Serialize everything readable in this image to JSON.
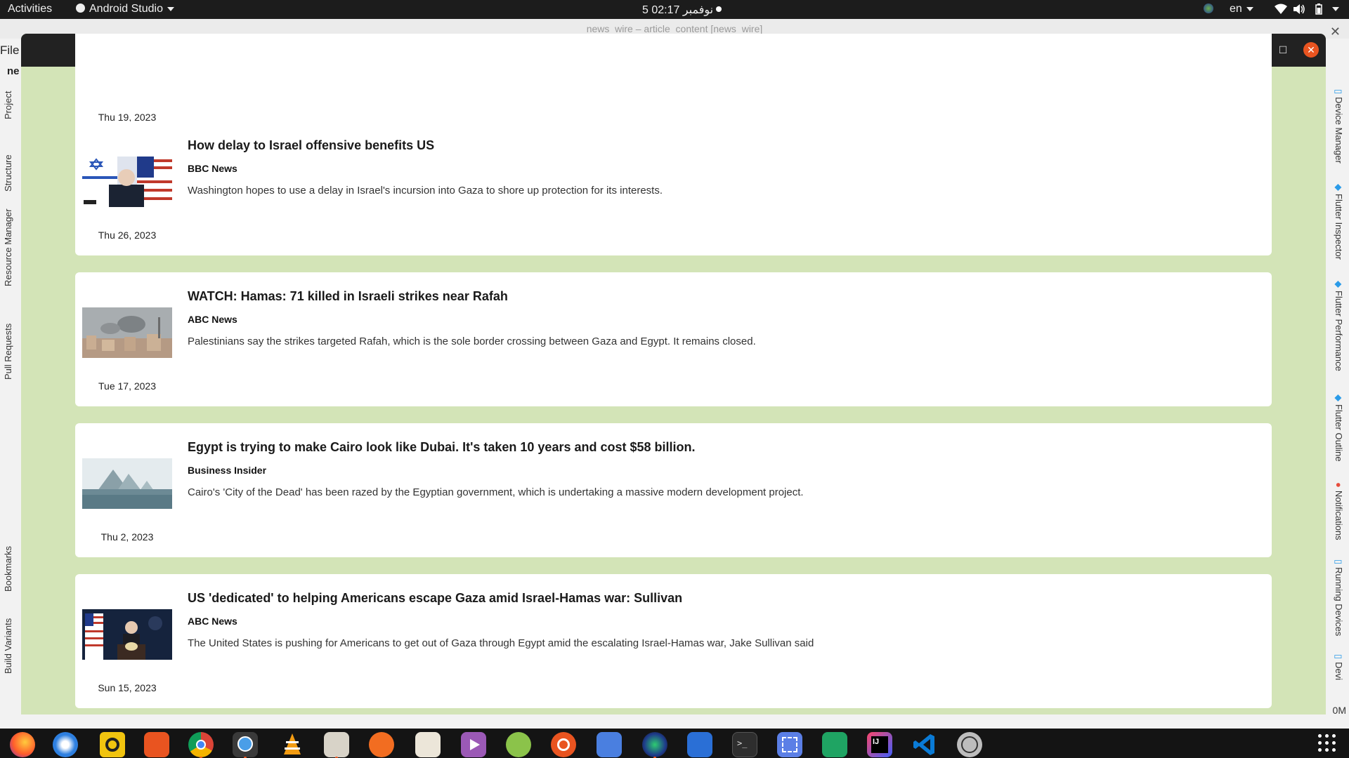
{
  "topbar": {
    "activities": "Activities",
    "app_menu": "Android Studio",
    "clock": "5 نوفمبر  02:17",
    "lang": "en"
  },
  "ide": {
    "window_title": "news_wire – article_content [news_wire]",
    "menu_file": "File",
    "menu_second": "ne",
    "left_tabs": [
      "Project",
      "Structure",
      "Resource Manager",
      "Pull Requests",
      "Bookmarks",
      "Build Variants"
    ],
    "right_tabs": [
      "Device Manager",
      "Flutter Inspector",
      "Flutter Performance",
      "Flutter Outline",
      "Notifications",
      "Running Devices",
      "Devi"
    ],
    "status_right": "0M"
  },
  "app": {
    "title": "news_wire",
    "articles": [
      {
        "headline": "",
        "source": "",
        "description": "",
        "date": "Thu 19, 2023"
      },
      {
        "headline": "How delay to Israel offensive benefits US",
        "source": "BBC News",
        "description": "Washington hopes to use a delay in Israel's incursion into Gaza to shore up protection for its interests.",
        "date": "Thu 26, 2023"
      },
      {
        "headline": "WATCH: Hamas: 71 killed in Israeli strikes near Rafah",
        "source": "ABC News",
        "description": "Palestinians say the strikes targeted Rafah, which is the sole border crossing between Gaza and Egypt. It remains closed.",
        "date": "Tue 17, 2023"
      },
      {
        "headline": "Egypt is trying to make Cairo look like Dubai. It's taken 10 years and cost $58 billion.",
        "source": "Business Insider",
        "description": "Cairo's 'City of the Dead' has been razed by the Egyptian government, which is undertaking a massive modern development project.",
        "date": "Thu 2, 2023"
      },
      {
        "headline": "US 'dedicated' to helping Americans escape Gaza amid Israel-Hamas war: Sullivan",
        "source": "ABC News",
        "description": "The United States is pushing for Americans to get out of Gaza through Egypt amid the escalating Israel-Hamas war, Jake Sullivan said",
        "date": "Sun 15, 2023"
      }
    ]
  },
  "dock": {
    "apps": [
      "firefox-icon",
      "thunderbird-icon",
      "rhythmbox-icon",
      "app-center-icon",
      "chrome-icon",
      "android-studio-icon",
      "vlc-icon",
      "files-icon",
      "inkscape-icon",
      "document-viewer-icon",
      "video-player-icon",
      "gnome-boxes-icon",
      "ubuntu-icon",
      "todo-icon",
      "darktable-icon",
      "writer-icon",
      "terminal-icon",
      "screenshot-icon",
      "calc-icon",
      "intellij-icon",
      "vscode-icon",
      "software-updater-icon"
    ]
  }
}
